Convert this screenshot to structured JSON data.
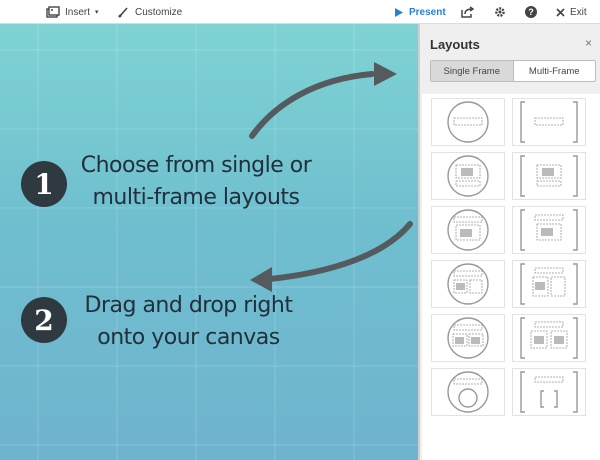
{
  "toolbar": {
    "insert_label": "Insert",
    "customize_label": "Customize",
    "present_label": "Present",
    "exit_label": "Exit",
    "colors": {
      "present": "#2a7fd4"
    }
  },
  "canvas": {
    "step1": {
      "number": "1",
      "line1": "Choose from single or",
      "line2": "multi-frame layouts"
    },
    "step2": {
      "number": "2",
      "line1": "Drag and drop right",
      "line2": "onto your canvas"
    },
    "colors": {
      "top": "#7fd3d3",
      "bottom": "#6fb3cf",
      "text": "#22303c",
      "arrow": "#555a5e"
    }
  },
  "panel": {
    "title": "Layouts",
    "close": "×",
    "tabs": [
      {
        "label": "Single Frame",
        "active": true
      },
      {
        "label": "Multi-Frame",
        "active": false
      }
    ],
    "layouts": [
      {
        "name": "circle-title",
        "frame": "circle"
      },
      {
        "name": "bracket-title",
        "frame": "bracket"
      },
      {
        "name": "circle-image-caption",
        "frame": "circle"
      },
      {
        "name": "bracket-image-caption",
        "frame": "bracket"
      },
      {
        "name": "circle-title-image",
        "frame": "circle"
      },
      {
        "name": "bracket-title-image",
        "frame": "bracket"
      },
      {
        "name": "circle-title-image-text",
        "frame": "circle"
      },
      {
        "name": "bracket-title-image-text",
        "frame": "bracket"
      },
      {
        "name": "circle-title-two-images",
        "frame": "circle"
      },
      {
        "name": "bracket-title-two-images",
        "frame": "bracket"
      },
      {
        "name": "circle-title-subcircle",
        "frame": "circle"
      },
      {
        "name": "bracket-title-subbracket",
        "frame": "bracket"
      }
    ]
  }
}
